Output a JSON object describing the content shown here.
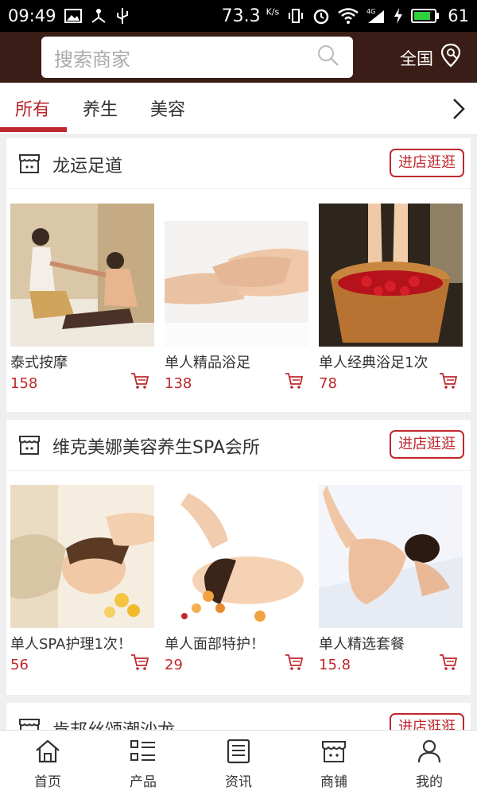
{
  "status_bar": {
    "time": "09:49",
    "speed": "73.3",
    "speed_unit": "K/s",
    "battery": "61"
  },
  "header": {
    "search_placeholder": "搜索商家",
    "region_label": "全国"
  },
  "tabs": [
    {
      "label": "所有",
      "active": true
    },
    {
      "label": "养生",
      "active": false
    },
    {
      "label": "美容",
      "active": false
    }
  ],
  "stores": [
    {
      "name": "龙运足道",
      "enter_label": "进店逛逛",
      "products": [
        {
          "title": "泰式按摩",
          "price": "158"
        },
        {
          "title": "单人精品浴足",
          "price": "138"
        },
        {
          "title": "单人经典浴足1次",
          "price": "78"
        }
      ]
    },
    {
      "name": "维克美娜美容养生SPA会所",
      "enter_label": "进店逛逛",
      "products": [
        {
          "title": "单人SPA护理1次！",
          "price": "56"
        },
        {
          "title": "单人面部特护！",
          "price": "29"
        },
        {
          "title": "单人精选套餐",
          "price": "15.8"
        }
      ]
    },
    {
      "name": "肯邦丝颂潮沙龙",
      "enter_label": "进店逛逛"
    }
  ],
  "bottom_nav": [
    {
      "label": "首页",
      "icon": "home-icon"
    },
    {
      "label": "产品",
      "icon": "list-icon"
    },
    {
      "label": "资讯",
      "icon": "news-icon"
    },
    {
      "label": "商铺",
      "icon": "shop-icon"
    },
    {
      "label": "我的",
      "icon": "user-icon"
    }
  ],
  "colors": {
    "header_bg": "#3a1d16",
    "accent": "#c0272d"
  }
}
